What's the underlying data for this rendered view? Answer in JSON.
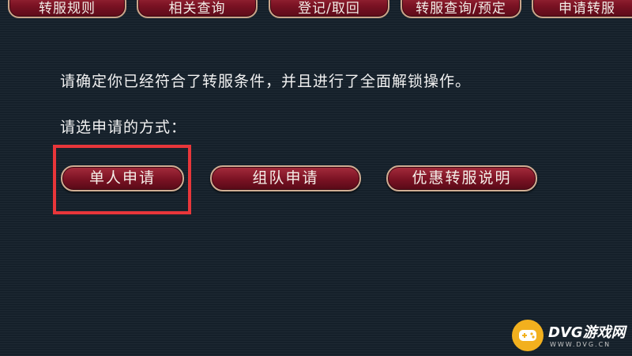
{
  "tabs": [
    {
      "label": "转服规则"
    },
    {
      "label": "相关查询"
    },
    {
      "label": "登记/取回"
    },
    {
      "label": "转服查询/预定"
    },
    {
      "label": "申请转服"
    }
  ],
  "main": {
    "confirm_text": "请确定你已经符合了转服条件，并且进行了全面解锁操作。",
    "choose_text": "请选申请的方式：",
    "buttons": {
      "single": "单人申请",
      "team": "组队申请",
      "discount": "优惠转服说明"
    }
  },
  "watermark": {
    "brand": "DVG游戏网",
    "url": "WWW.DVG.CN"
  },
  "colors": {
    "background": "#15202a",
    "button_fill": "#7a1223",
    "button_border": "#d0ad93",
    "highlight": "#e8363a",
    "logo_accent": "#f2b01e"
  }
}
